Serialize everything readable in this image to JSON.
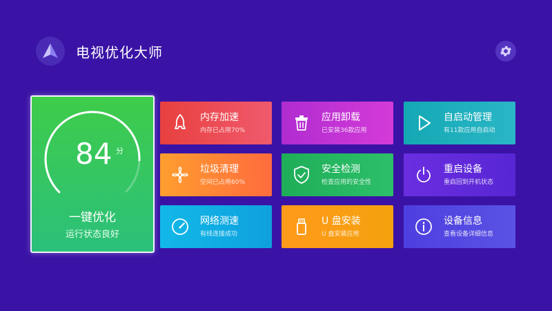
{
  "header": {
    "title": "电视优化大师",
    "logo_icon": "paper-plane-logo",
    "settings_icon": "gear-icon"
  },
  "main": {
    "score": "84",
    "score_unit": "分",
    "progress": 0.84,
    "title": "一键优化",
    "subtitle": "运行状态良好"
  },
  "cards": [
    {
      "title": "内存加速",
      "subtitle": "内存已占用70%",
      "icon": "rocket-icon"
    },
    {
      "title": "应用卸载",
      "subtitle": "已安装36款应用",
      "icon": "trash-icon"
    },
    {
      "title": "自启动管理",
      "subtitle": "有11款应用自启动",
      "icon": "play-icon"
    },
    {
      "title": "垃圾清理",
      "subtitle": "空间已占用60%",
      "icon": "fan-icon"
    },
    {
      "title": "安全检测",
      "subtitle": "检查应用的安全性",
      "icon": "shield-check-icon"
    },
    {
      "title": "重启设备",
      "subtitle": "重启回到开机状态",
      "icon": "power-icon"
    },
    {
      "title": "网络测速",
      "subtitle": "有线连接成功",
      "icon": "speedometer-icon"
    },
    {
      "title": "U 盘安装",
      "subtitle": "U 盘安装应用",
      "icon": "usb-drive-icon"
    },
    {
      "title": "设备信息",
      "subtitle": "查看设备详细信息",
      "icon": "info-icon"
    }
  ],
  "colors": {
    "background": "#3a13a6",
    "main_tile_top": "#3fcc4a",
    "main_tile_bottom": "#2bc07a"
  }
}
